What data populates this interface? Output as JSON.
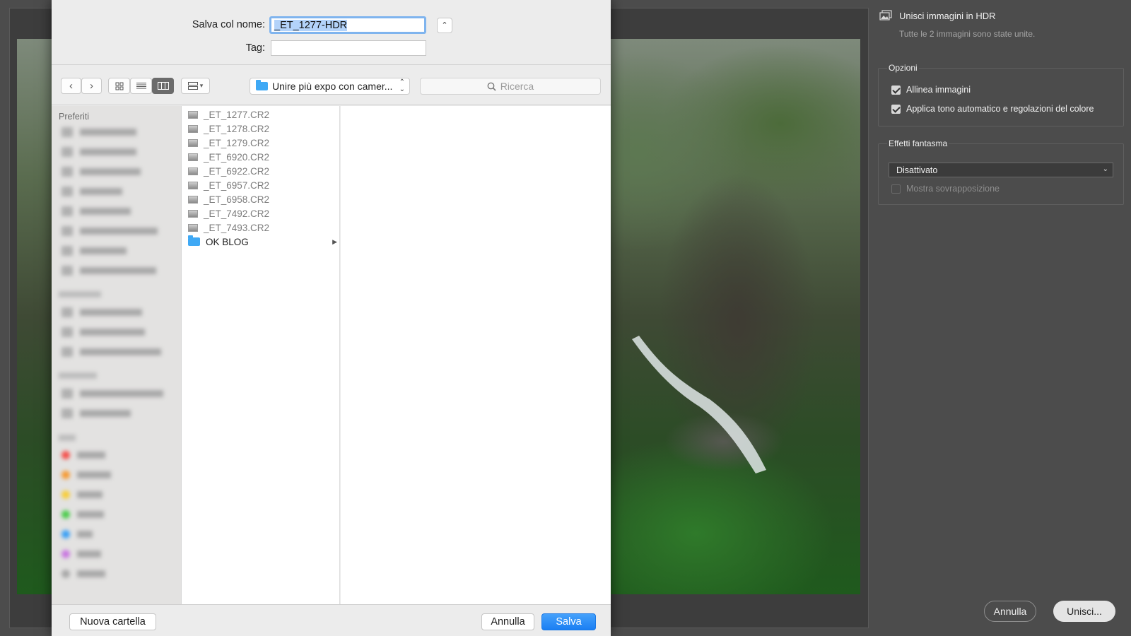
{
  "hdr_panel": {
    "title": "Unisci immagini in HDR",
    "subtitle": "Tutte le 2 immagini sono state unite.",
    "options_title": "Opzioni",
    "align_label": "Allinea immagini",
    "align_checked": true,
    "auto_tone_label": "Applica tono automatico e regolazioni del colore",
    "auto_tone_checked": true,
    "ghost_title": "Effetti fantasma",
    "ghost_value": "Disattivato",
    "overlay_label": "Mostra sovrapposizione",
    "overlay_checked": false,
    "cancel_label": "Annulla",
    "merge_label": "Unisci..."
  },
  "save_dialog": {
    "name_label": "Salva col nome:",
    "name_value": "_ET_1277-HDR",
    "tag_label": "Tag:",
    "tag_value": "",
    "path_label": "Unire più expo con camer...",
    "search_placeholder": "Ricerca",
    "sidebar_heading": "Preferiti",
    "files": [
      {
        "name": "_ET_1277.CR2",
        "type": "file"
      },
      {
        "name": "_ET_1278.CR2",
        "type": "file"
      },
      {
        "name": "_ET_1279.CR2",
        "type": "file"
      },
      {
        "name": "_ET_6920.CR2",
        "type": "file"
      },
      {
        "name": "_ET_6922.CR2",
        "type": "file"
      },
      {
        "name": "_ET_6957.CR2",
        "type": "file"
      },
      {
        "name": "_ET_6958.CR2",
        "type": "file"
      },
      {
        "name": "_ET_7492.CR2",
        "type": "file"
      },
      {
        "name": "_ET_7493.CR2",
        "type": "file"
      },
      {
        "name": "OK BLOG",
        "type": "folder"
      }
    ],
    "new_folder_label": "Nuova cartella",
    "cancel_label": "Annulla",
    "save_label": "Salva"
  },
  "colors": {
    "accent": "#1b7ff3",
    "folder": "#3fa9f5",
    "tag_red": "#f4524d",
    "tag_orange": "#f59b35",
    "tag_yellow": "#f7cd3a",
    "tag_green": "#4ccc4c",
    "tag_blue": "#3aa0f5",
    "tag_purple": "#c977e0",
    "tag_gray": "#a8a8a8"
  }
}
